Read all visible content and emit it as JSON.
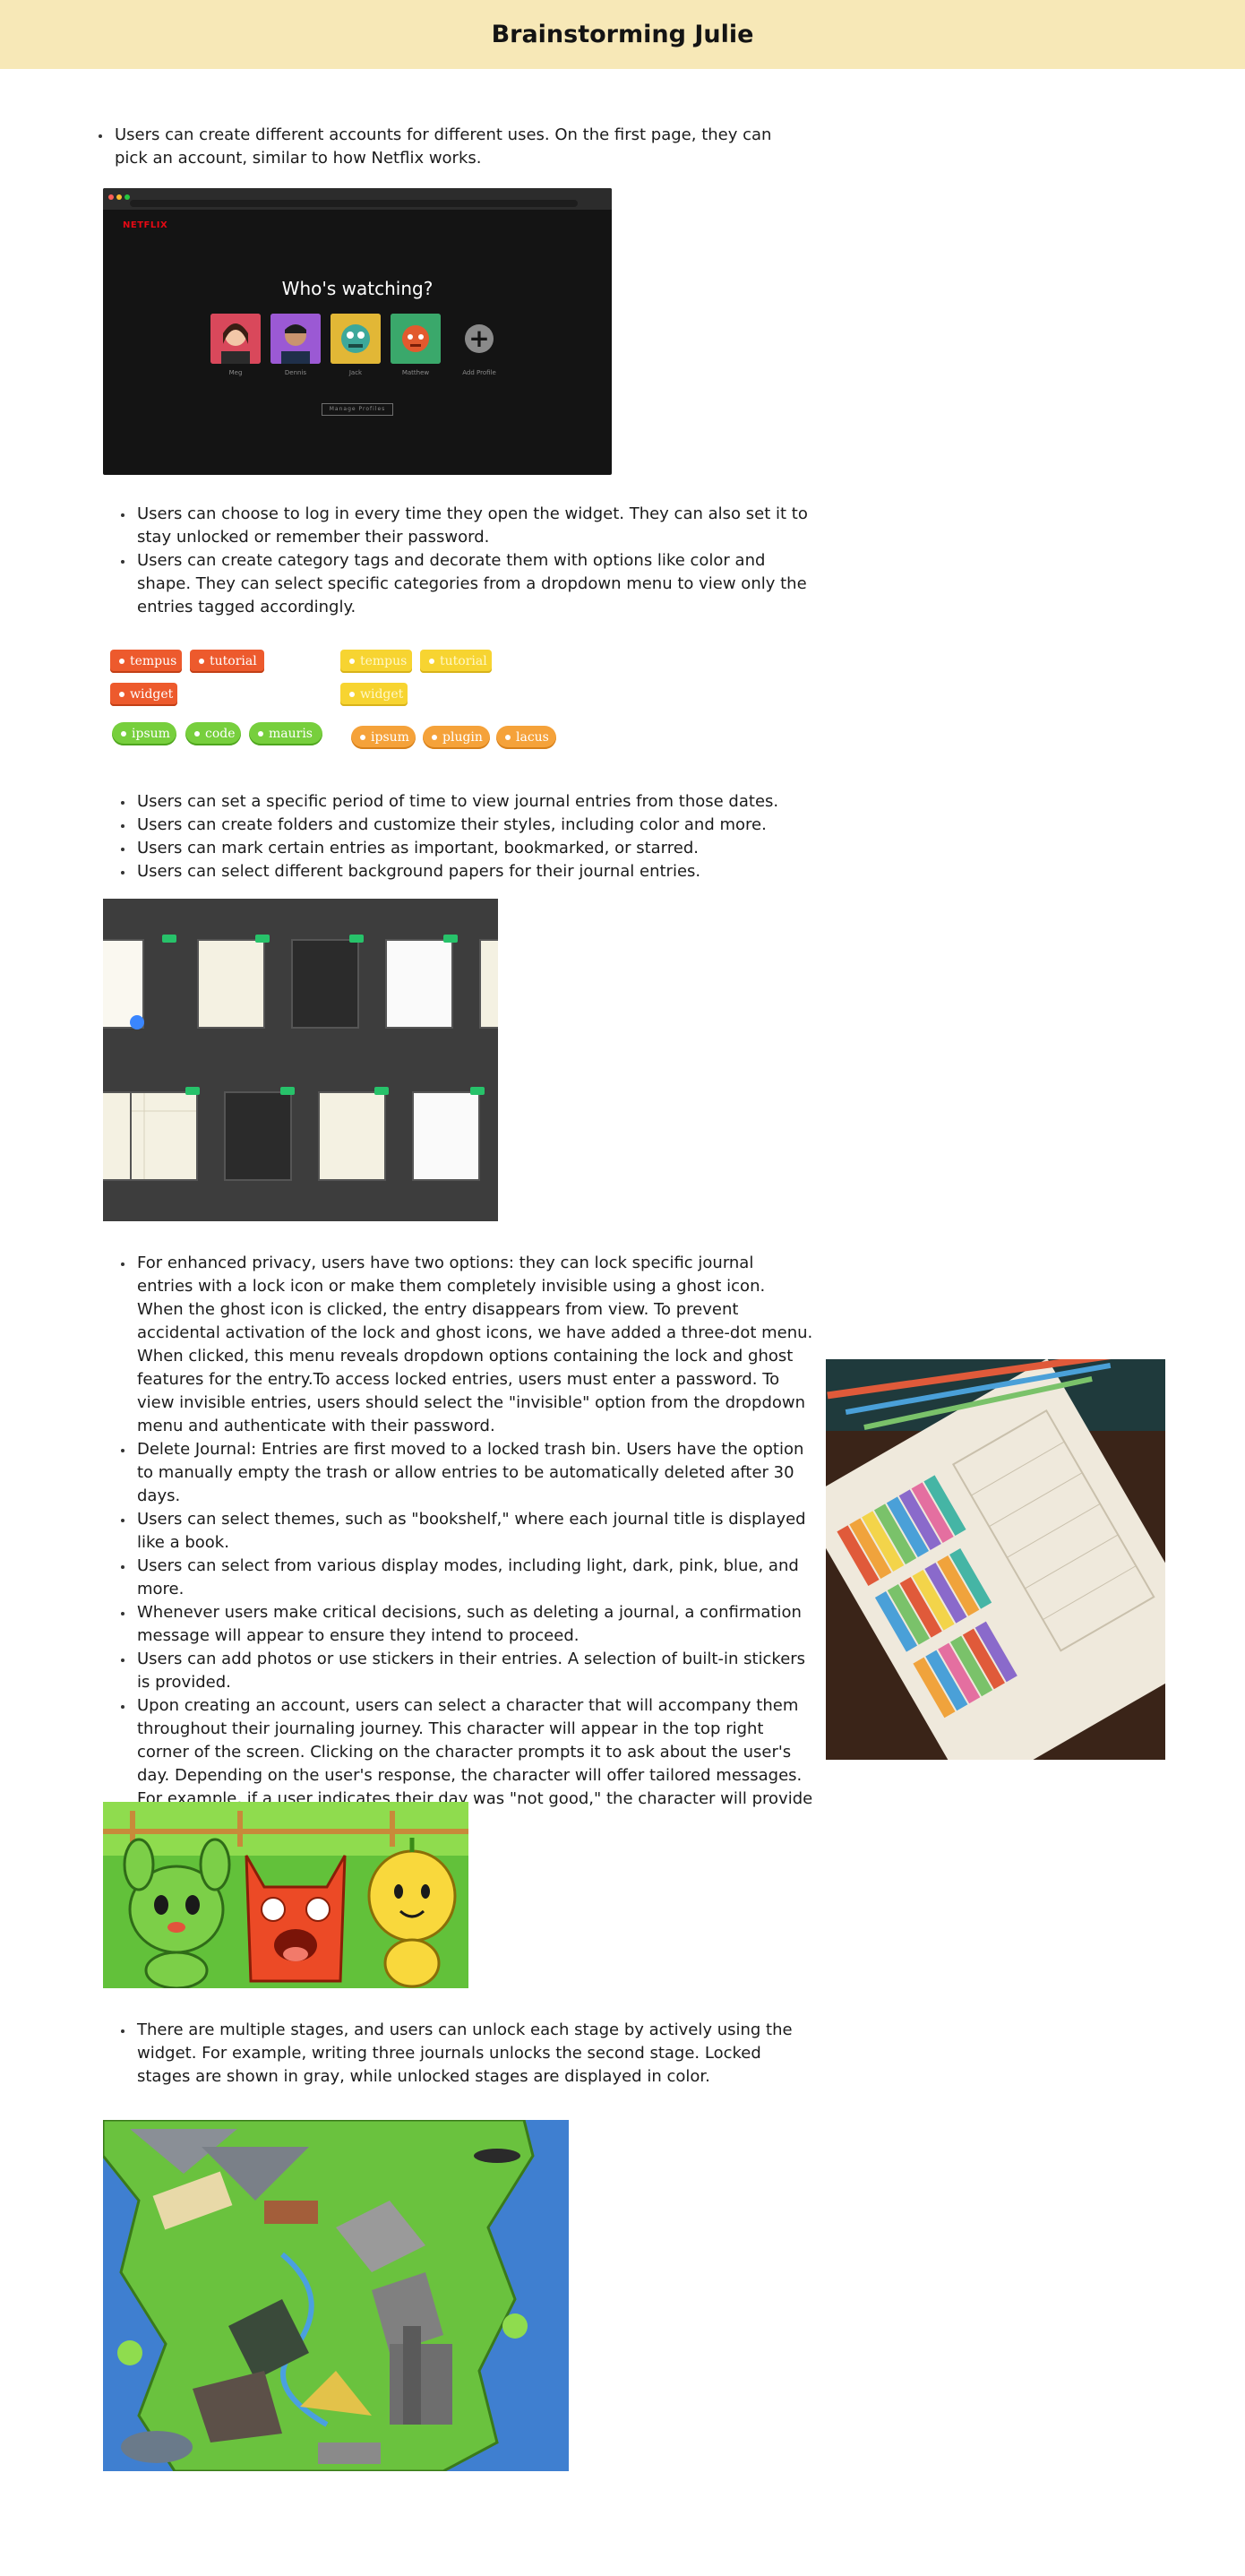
{
  "page_title": "Brainstorming Julie",
  "section1": {
    "bullets": [
      "Users can create different accounts for different uses. On the first page, they can pick an account, similar to how Netflix works."
    ]
  },
  "netflix": {
    "logo": "NETFLIX",
    "title": "Who's watching?",
    "profiles": [
      {
        "name": "Meg",
        "color": "#d9485b"
      },
      {
        "name": "Dennis",
        "color": "#9b59d4"
      },
      {
        "name": "Jack",
        "color": "#e2b736"
      },
      {
        "name": "Matthew",
        "color": "#3aa86b"
      },
      {
        "name": "Add Profile",
        "color": "#8a8a8a"
      }
    ],
    "manage_label": "Manage Profiles"
  },
  "section2": {
    "bullets": [
      "Users can choose to log in every time they open the widget. They can also set it to stay unlocked or remember their password.",
      "Users can create category tags and decorate them with options like color and shape. They can select specific categories from a dropdown menu to view only the entries tagged accordingly."
    ]
  },
  "tags": {
    "red": [
      "tempus",
      "tutorial",
      "widget"
    ],
    "yellow": [
      "tempus",
      "tutorial",
      "widget"
    ],
    "green": [
      "ipsum",
      "code",
      "mauris"
    ],
    "orange": [
      "ipsum",
      "plugin",
      "lacus"
    ],
    "colors": {
      "red": "#ed5a2d",
      "yellow": "#f7d431",
      "green": "#77cf3d",
      "orange": "#f5a23a"
    }
  },
  "section3": {
    "bullets": [
      "Users can set a specific period of time to view journal entries from those dates.",
      "Users can create folders and customize their styles, including color and more.",
      "Users can mark certain entries as important, bookmarked, or starred.",
      "Users can select different background papers for their journal entries."
    ]
  },
  "section4": {
    "bullets": [
      "For enhanced privacy, users have two options: they can lock specific journal entries with a lock icon or make them completely invisible using a ghost icon. When the ghost icon is clicked, the entry disappears from view. To prevent accidental activation of the lock and ghost icons, we have added a three-dot menu. When clicked, this menu reveals dropdown options containing the lock and ghost features for the entry.To access locked entries, users must enter a password. To view invisible entries, users should select the \"invisible\" option from the dropdown menu and authenticate with their password.",
      "Delete Journal: Entries are first moved to a locked trash bin. Users have the option to manually empty the trash or allow entries to be automatically deleted after 30 days.",
      "Users can select themes, such as \"bookshelf,\" where each journal title is displayed like a book.",
      "Users can select from various display modes, including light, dark, pink, blue, and more.",
      "Whenever users make critical decisions, such as deleting a journal, a confirmation message will appear to ensure they intend to proceed.",
      "Users can add photos or use stickers in their entries. A selection of built-in stickers is provided.",
      "Upon creating an account, users can select a character that will accompany them throughout their journaling journey. This character will appear in the top right corner of the screen. Clicking on the character prompts it to ask about the user's day. Depending on the user's response, the character will offer tailored messages. For example, if a user indicates their day was \"not good,\" the character will provide an encouraging message."
    ]
  },
  "section5": {
    "bullets": [
      "There are multiple stages, and users can unlock each stage by actively using the widget. For example, writing three journals unlocks the second stage. Locked stages are shown in gray, while unlocked stages are displayed in color."
    ]
  }
}
